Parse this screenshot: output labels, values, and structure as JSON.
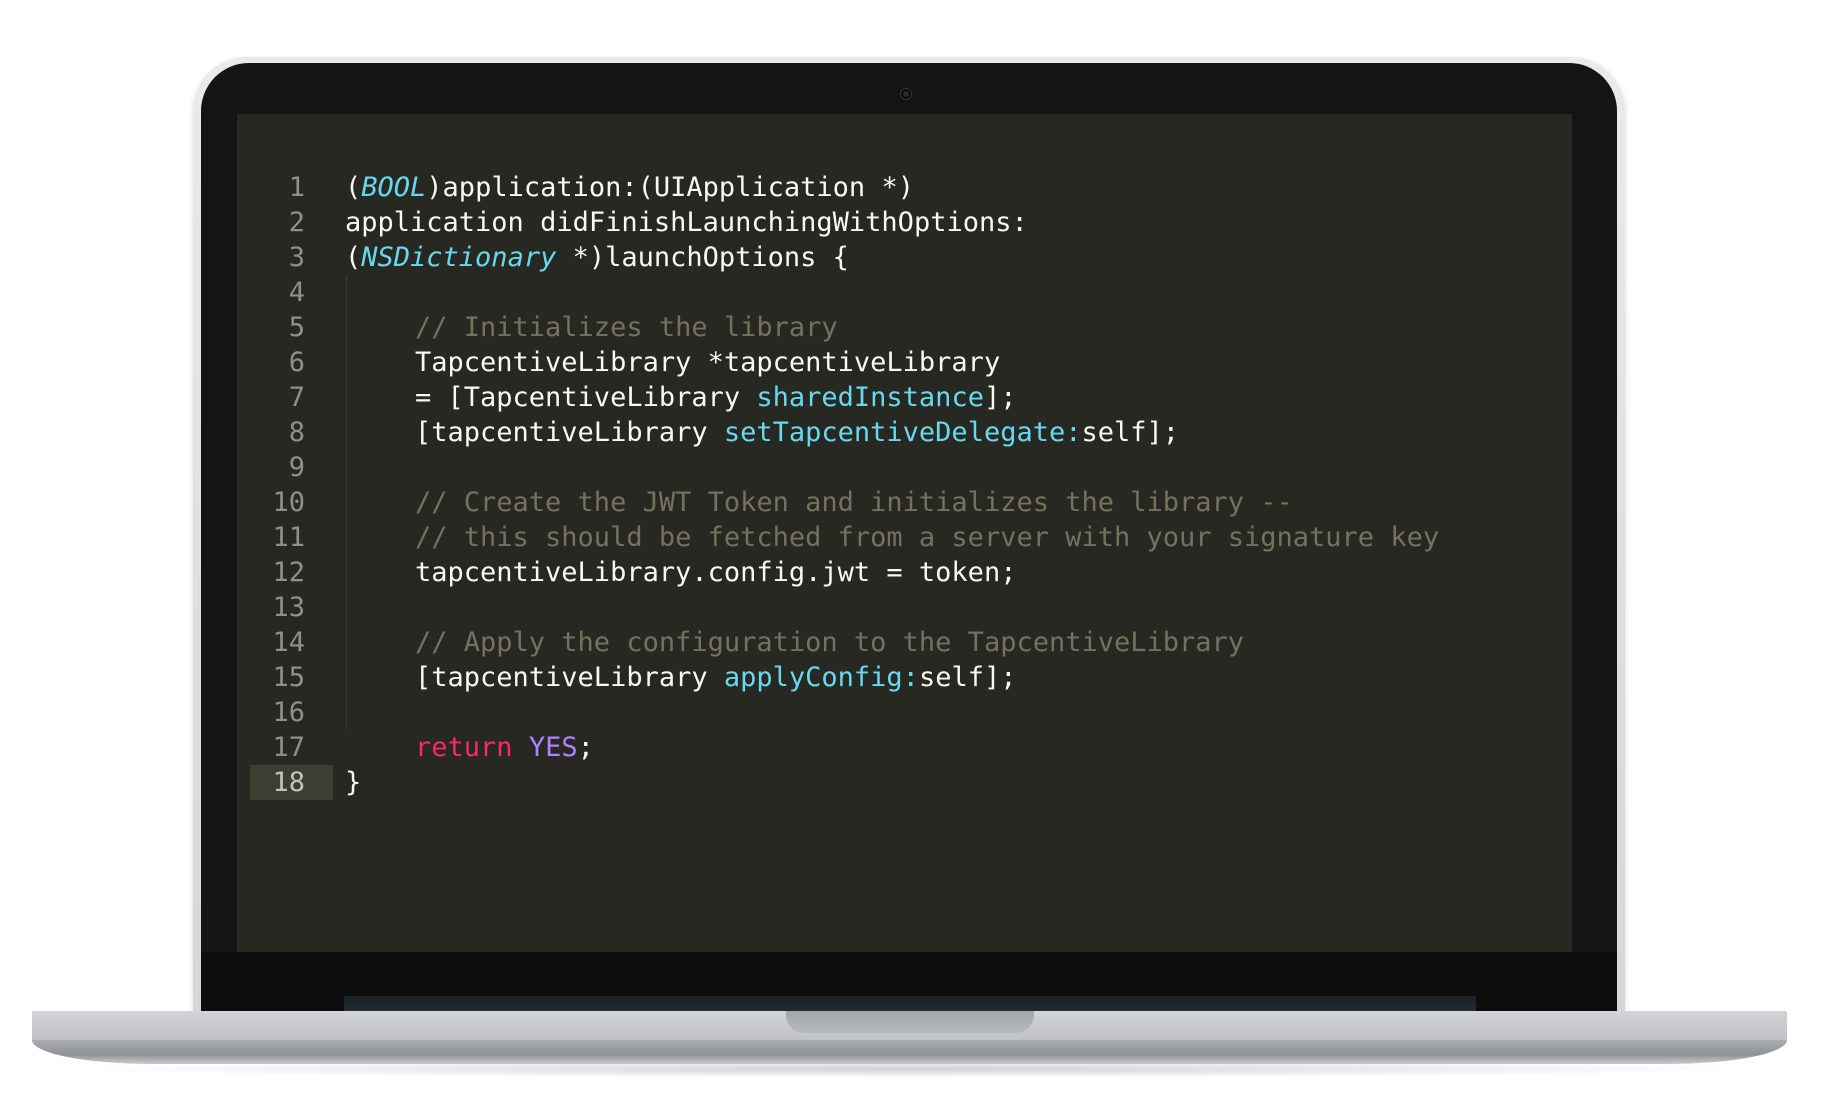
{
  "editor": {
    "theme_colors": {
      "background": "#272822",
      "text": "#f8f8f2",
      "type": "#66d9ef",
      "comment": "#75715e",
      "keyword": "#f92672",
      "constant": "#ae81ff",
      "line_number": "#8f908a"
    },
    "active_line": 18,
    "lines": [
      {
        "number": "1",
        "tokens": [
          {
            "text": "(",
            "kind": "plain"
          },
          {
            "text": "BOOL",
            "kind": "type"
          },
          {
            "text": ")application:(UIApplication *)",
            "kind": "plain"
          }
        ]
      },
      {
        "number": "2",
        "tokens": [
          {
            "text": "application didFinishLaunchingWithOptions:",
            "kind": "plain"
          }
        ]
      },
      {
        "number": "3",
        "tokens": [
          {
            "text": "(",
            "kind": "plain"
          },
          {
            "text": "NSDictionary",
            "kind": "type"
          },
          {
            "text": " *)launchOptions {",
            "kind": "plain"
          }
        ]
      },
      {
        "number": "4",
        "tokens": []
      },
      {
        "number": "5",
        "tokens": [
          {
            "text": "// Initializes the library",
            "kind": "comment"
          }
        ]
      },
      {
        "number": "6",
        "tokens": [
          {
            "text": "TapcentiveLibrary *tapcentiveLibrary",
            "kind": "plain"
          }
        ]
      },
      {
        "number": "7",
        "tokens": [
          {
            "text": "= [TapcentiveLibrary ",
            "kind": "plain"
          },
          {
            "text": "sharedInstance",
            "kind": "func"
          },
          {
            "text": "];",
            "kind": "plain"
          }
        ]
      },
      {
        "number": "8",
        "tokens": [
          {
            "text": "[tapcentiveLibrary ",
            "kind": "plain"
          },
          {
            "text": "setTapcentiveDelegate:",
            "kind": "func"
          },
          {
            "text": "self];",
            "kind": "plain"
          }
        ]
      },
      {
        "number": "9",
        "tokens": []
      },
      {
        "number": "10",
        "tokens": [
          {
            "text": "// Create the JWT Token and initializes the library --",
            "kind": "comment"
          }
        ]
      },
      {
        "number": "11",
        "tokens": [
          {
            "text": "// this should be fetched from a server with your signature key",
            "kind": "comment"
          }
        ]
      },
      {
        "number": "12",
        "tokens": [
          {
            "text": "tapcentiveLibrary.config.jwt = token;",
            "kind": "plain"
          }
        ]
      },
      {
        "number": "13",
        "tokens": []
      },
      {
        "number": "14",
        "tokens": [
          {
            "text": "// Apply the configuration to the TapcentiveLibrary",
            "kind": "comment"
          }
        ]
      },
      {
        "number": "15",
        "tokens": [
          {
            "text": "[tapcentiveLibrary ",
            "kind": "plain"
          },
          {
            "text": "applyConfig:",
            "kind": "func"
          },
          {
            "text": "self];",
            "kind": "plain"
          }
        ]
      },
      {
        "number": "16",
        "tokens": []
      },
      {
        "number": "17",
        "tokens": [
          {
            "text": "return",
            "kind": "kw"
          },
          {
            "text": " ",
            "kind": "plain"
          },
          {
            "text": "YES",
            "kind": "const"
          },
          {
            "text": ";",
            "kind": "plain"
          }
        ]
      },
      {
        "number": "18",
        "tokens": [
          {
            "text": "}",
            "kind": "plain"
          }
        ]
      }
    ]
  }
}
